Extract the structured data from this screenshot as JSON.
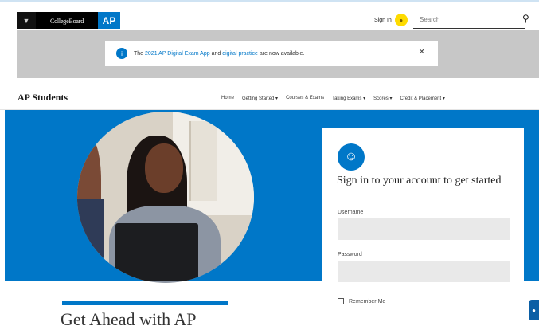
{
  "header": {
    "brand": {
      "collegeboard": "CollegeBoard",
      "ap": "AP"
    },
    "signin_label": "Sign In",
    "search_placeholder": "Search"
  },
  "notice": {
    "prefix": "The",
    "link1": "2021 AP Digital Exam App",
    "middle": "and",
    "link2": "digital practice",
    "suffix": "are now available."
  },
  "subnav": {
    "title": "AP Students",
    "items": [
      "Home",
      "Getting Started ▾",
      "Courses & Exams",
      "Taking Exams ▾",
      "Scores ▾",
      "Credit & Placement ▾"
    ]
  },
  "signin_card": {
    "heading": "Sign in to your account to get started",
    "username_label": "Username",
    "password_label": "Password",
    "remember_label": "Remember Me"
  },
  "main": {
    "headline": "Get Ahead with AP"
  },
  "colors": {
    "accent": "#0077c8",
    "notice_band": "#c7c7c7",
    "avatar": "#fedb00"
  }
}
